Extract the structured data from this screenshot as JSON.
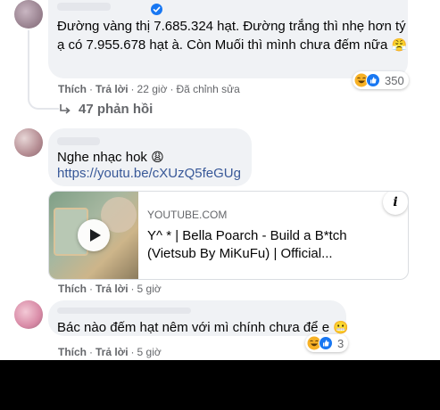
{
  "comments": [
    {
      "text": "Đường vàng thị 7.685.324 hạt. Đường trắng thì nhẹ hơn tý ạ có 7.955.678 hạt à. Còn Muối thì mình chưa đếm nữa",
      "emoji": "😤",
      "like": "Thích",
      "reply": "Trả lời",
      "time": "22 giờ",
      "edited": "Đã chỉnh sửa",
      "reaction_count": "350",
      "replies": "47 phản hồi"
    },
    {
      "text": "Nghe nhạc hok",
      "emoji": "😩",
      "link": "https://youtu.be/cXUzQ5feGUg",
      "like": "Thích",
      "reply": "Trả lời",
      "time": "5 giờ"
    },
    {
      "text": "Bác nào đếm hạt nêm với mì chính chưa để e",
      "emoji": "😬",
      "like": "Thích",
      "reply": "Trả lời",
      "time": "5 giờ",
      "reaction_count": "3"
    }
  ],
  "preview": {
    "domain": "YOUTUBE.COM",
    "title": "Y^         * | Bella Poarch - Build a B*tch (Vietsub By MiKuFu) | Official...",
    "info": "i"
  },
  "colors": {
    "bubble": "#f0f2f5",
    "meta_text": "#65676b",
    "link": "#385898",
    "like_blue": "#1877f2",
    "haha_yellow": "#f7b125"
  }
}
